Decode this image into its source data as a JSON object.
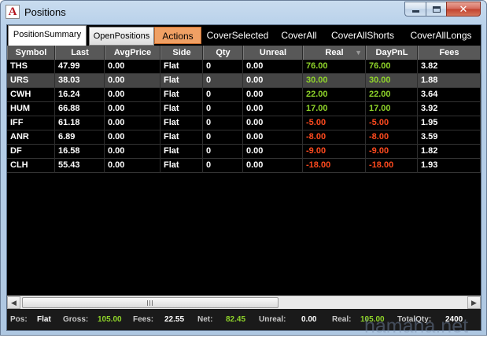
{
  "window": {
    "title": "Positions",
    "app_icon_letter": "A"
  },
  "caption_buttons": {
    "close_glyph": "✕"
  },
  "tabs": {
    "summary": "PositionSummary",
    "open": "OpenPositions"
  },
  "toolbar": {
    "actions": "Actions",
    "cover_selected": "CoverSelected",
    "cover_all": "CoverAll",
    "cover_all_shorts": "CoverAllShorts",
    "cover_all_longs": "CoverAllLongs"
  },
  "table": {
    "columns": [
      "Symbol",
      "Last",
      "AvgPrice",
      "Side",
      "Qty",
      "Unreal",
      "Real",
      "DayPnL",
      "Fees"
    ],
    "sort_indicator": "▼",
    "selected_row": 1,
    "rows": [
      [
        "THS",
        "47.99",
        "0.00",
        "Flat",
        "0",
        "0.00",
        "76.00",
        "76.00",
        "3.82"
      ],
      [
        "URS",
        "38.03",
        "0.00",
        "Flat",
        "0",
        "0.00",
        "30.00",
        "30.00",
        "1.88"
      ],
      [
        "CWH",
        "16.24",
        "0.00",
        "Flat",
        "0",
        "0.00",
        "22.00",
        "22.00",
        "3.64"
      ],
      [
        "HUM",
        "66.88",
        "0.00",
        "Flat",
        "0",
        "0.00",
        "17.00",
        "17.00",
        "3.92"
      ],
      [
        "IFF",
        "61.18",
        "0.00",
        "Flat",
        "0",
        "0.00",
        "-5.00",
        "-5.00",
        "1.95"
      ],
      [
        "ANR",
        "6.89",
        "0.00",
        "Flat",
        "0",
        "0.00",
        "-8.00",
        "-8.00",
        "3.59"
      ],
      [
        "DF",
        "16.58",
        "0.00",
        "Flat",
        "0",
        "0.00",
        "-9.00",
        "-9.00",
        "1.82"
      ],
      [
        "CLH",
        "55.43",
        "0.00",
        "Flat",
        "0",
        "0.00",
        "-18.00",
        "-18.00",
        "1.93"
      ]
    ]
  },
  "scrollbar": {
    "left_arrow": "◀",
    "right_arrow": "▶"
  },
  "status": {
    "pos_label": "Pos:",
    "pos_value": "Flat",
    "gross_label": "Gross:",
    "gross_value": "105.00",
    "fees_label": "Fees:",
    "fees_value": "22.55",
    "net_label": "Net:",
    "net_value": "82.45",
    "unreal_label": "Unreal:",
    "unreal_value": "0.00",
    "real_label": "Real:",
    "real_value": "105.00",
    "totalqty_label": "TotalQty:",
    "totalqty_value": "2400"
  },
  "watermark": "hamaha.net",
  "colors": {
    "positive": "#8fd42a",
    "negative": "#ff4a1e",
    "actions_bg": "#f0a064",
    "selected_row": "#454545"
  }
}
